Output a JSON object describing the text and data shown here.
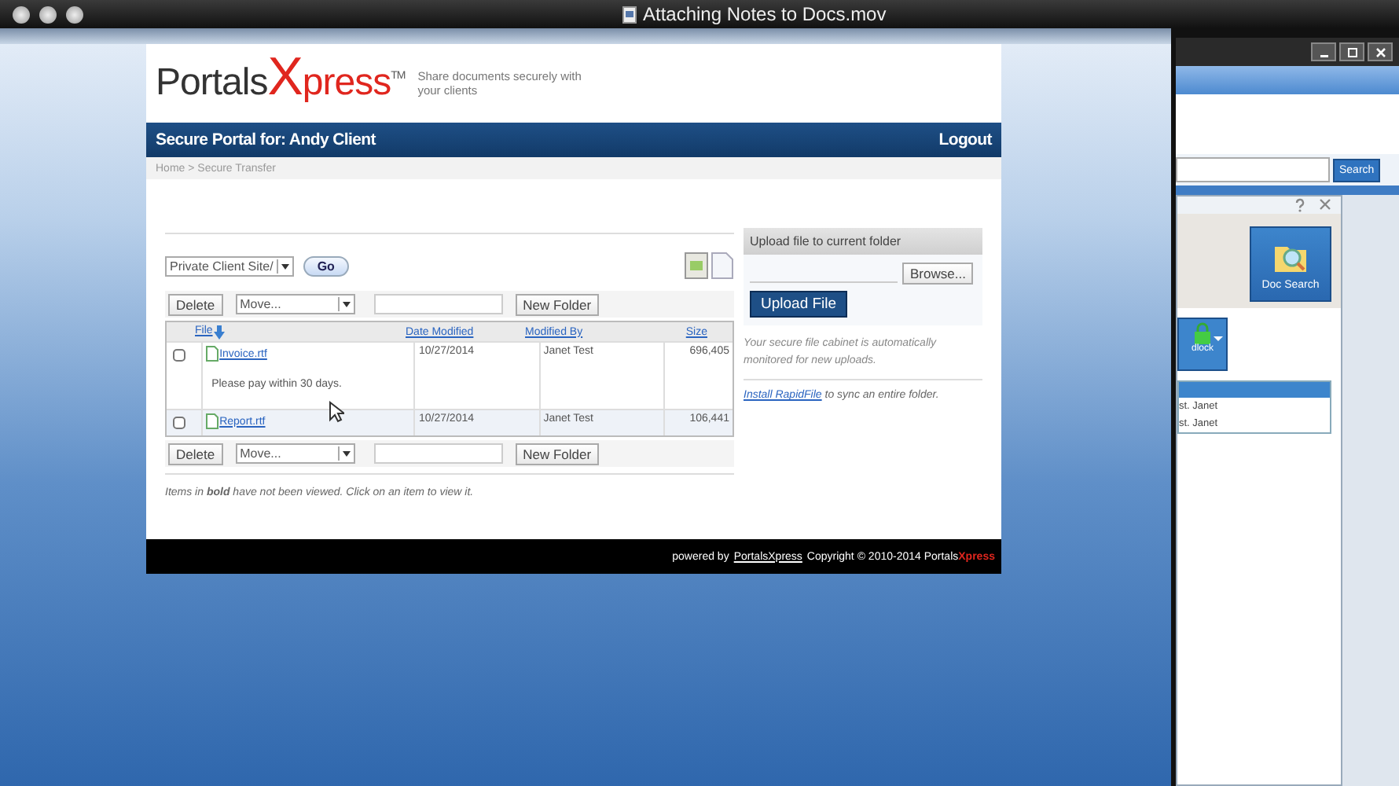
{
  "player": {
    "title": "Attaching Notes to Docs.mov"
  },
  "logo": {
    "part_1": "Portals",
    "part_2": "X",
    "part_3": "press",
    "mark": "TM"
  },
  "tagline": "Share documents securely with your clients",
  "nav": {
    "title": "Secure Portal for: Andy Client",
    "logout": "Logout"
  },
  "breadcrumb": "Home > Secure Transfer",
  "folder": {
    "value": "Private Client Site/",
    "go": "Go"
  },
  "toolbars": [
    {
      "delete": "Delete",
      "move": "Move...",
      "new_folder": "New Folder"
    },
    {
      "delete": "Delete",
      "move": "Move...",
      "new_folder": "New Folder"
    }
  ],
  "columns": [
    "File",
    "Date Modified",
    "Modified By",
    "Size"
  ],
  "rows": [
    {
      "file": "Invoice.rtf",
      "note": "Please pay within 30 days.",
      "date": "10/27/2014",
      "by": "Janet Test",
      "size": "696,405",
      "checked": false
    },
    {
      "file": "Report.rtf",
      "date": "10/27/2014",
      "by": "Janet Test",
      "size": "106,441",
      "checked": false
    }
  ],
  "hint": "Items in **bold** have not been viewed. Click on an item to view it.",
  "upload": {
    "title": "Upload file to current folder",
    "browse": "Browse...",
    "button": "Upload File",
    "info": "Your secure file cabinet is automatically monitored for new uploads.",
    "link": "Install RapidFile",
    "link_rest": "to sync an entire folder."
  },
  "footer": {
    "prefix": "powered by",
    "brand": "PortalsXpress",
    "copyright": "Copyright © 2010-2014 Portals",
    "brand_tail": "Xpress"
  },
  "side_window": {
    "search": "Search",
    "doc_search": "Doc Search",
    "lock_label": "dlock",
    "rows": [
      "st. Janet",
      "st. Janet"
    ]
  }
}
